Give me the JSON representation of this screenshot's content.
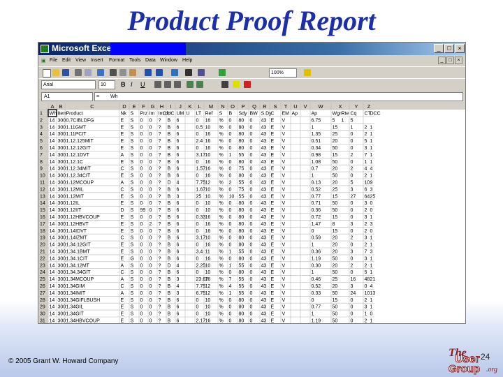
{
  "slide": {
    "title": "Product Proof Report",
    "footer": "© 2005 Grant W. Howard Company",
    "slide_number": "24",
    "logo": {
      "line1": "The",
      "line2": "User",
      "line3": "Group",
      "line4": ".org"
    }
  },
  "window": {
    "app_title": "Microsoft Excel -",
    "buttons": [
      "_",
      "□",
      "×"
    ],
    "doc_buttons": [
      "_",
      "□",
      "×"
    ]
  },
  "menu": [
    "File",
    "Edit",
    "View",
    "Insert",
    "Format",
    "Tools",
    "Data",
    "Window",
    "Help"
  ],
  "formatting": {
    "font": "Arial",
    "size": "10",
    "bold": "B",
    "italic": "I",
    "underline": "U",
    "zoom": "100%"
  },
  "formula_bar": {
    "cell_ref": "A1",
    "eq": "=",
    "content": "Wh"
  },
  "sheet": {
    "columns": [
      "A",
      "B",
      "C",
      "D",
      "E",
      "F",
      "G",
      "H",
      "I",
      "J",
      "K",
      "L",
      "M",
      "N",
      "O",
      "P",
      "Q",
      "R",
      "S",
      "T",
      "U",
      "V",
      "W",
      "X",
      "Y",
      "Z"
    ],
    "row_labels": [
      "1",
      "2",
      "3",
      "4",
      "5",
      "6",
      "7",
      "8",
      "9",
      "10",
      "11",
      "12",
      "13",
      "14",
      "15",
      "16",
      "17",
      "18",
      "19",
      "20",
      "21",
      "22",
      "23",
      "24",
      "25",
      "26",
      "27",
      "28",
      "29",
      "30",
      "31"
    ],
    "rows": [
      [
        "Wh",
        "Item",
        "Product",
        "Nk",
        "S",
        "Prz",
        "Im",
        "Im\\ndo",
        "C",
        "UC",
        "UM",
        "U",
        "LT",
        "Ref",
        "S",
        "B",
        "Sdy",
        "BW",
        "S.Dy",
        "C",
        "EM",
        "Ap",
        "Ap",
        "Wgn",
        "Rte",
        "Cq",
        "CT",
        "DCC"
      ],
      [
        "14",
        "300",
        "0.7CIBLDFG",
        "E",
        "S",
        "0",
        "0",
        "?",
        "",
        "B",
        "6",
        "",
        "0",
        "16",
        "%",
        "0",
        "80",
        "0",
        "43",
        "E",
        "V",
        "",
        "6.75",
        "5",
        "1",
        "5",
        "",
        ""
      ],
      [
        "14",
        "300",
        "1.11GMT",
        "E",
        "S",
        "0",
        "0",
        "?",
        "",
        "B",
        "6",
        "",
        "0.5",
        "10",
        "%",
        "0",
        "80",
        "0",
        "43",
        "E",
        "V",
        "",
        "1",
        "15",
        "",
        "1",
        "2",
        "1"
      ],
      [
        "14",
        "300",
        "1.11PCIT",
        "E",
        "S",
        "0",
        "0",
        "?",
        "",
        "B",
        "6",
        "",
        "0",
        "16",
        "%",
        "0",
        "80",
        "0",
        "43",
        "E",
        "V",
        "",
        "1.35",
        "25",
        "",
        "0",
        "2",
        "1"
      ],
      [
        "14",
        "300",
        "1.12.125MIT",
        "E",
        "S",
        "0",
        "0",
        "?",
        "",
        "B",
        "6",
        "",
        "2.4",
        "16",
        "%",
        "0",
        "80",
        "0",
        "43",
        "E",
        "V",
        "",
        "0.51",
        "20",
        "",
        "0",
        "5",
        "1"
      ],
      [
        "14",
        "300",
        "1.12.12GIT",
        "E",
        "S",
        "0",
        "0",
        "?",
        "",
        "B",
        "6",
        "",
        "0",
        "16",
        "%",
        "0",
        "80",
        "0",
        "43",
        "E",
        "V",
        "",
        "0.34",
        "50",
        "",
        "0",
        "3",
        "1"
      ],
      [
        "14",
        "300",
        "1.12.1DVT",
        "A",
        "S",
        "0",
        "0",
        "?",
        "",
        "B",
        "6",
        "",
        "3.17",
        "10",
        "%",
        "1",
        "55",
        "0",
        "43",
        "E",
        "V",
        "",
        "0.98",
        "15",
        "",
        "2",
        "7",
        "1"
      ],
      [
        "14",
        "300",
        "1.12.1C",
        "E",
        "S",
        "0",
        "0",
        "?",
        "",
        "B",
        "6",
        "",
        "0",
        "16",
        "%",
        "0",
        "80",
        "0",
        "43",
        "E",
        "V",
        "",
        "1.08",
        "50",
        "",
        "0",
        "1",
        "1"
      ],
      [
        "14",
        "300",
        "1.12.34MIT",
        "C",
        "S",
        "0",
        "0",
        "?",
        "",
        "B",
        "6",
        "",
        "1.57",
        "16",
        "%",
        "0",
        "75",
        "0",
        "43",
        "E",
        "V",
        "",
        "0.7",
        "20",
        "",
        "2",
        "4",
        "4"
      ],
      [
        "14",
        "300",
        "1.12.34CIT",
        "E",
        "S",
        "0",
        "0",
        "?",
        "",
        "B",
        "6",
        "",
        "0",
        "16",
        "%",
        "0",
        "80",
        "0",
        "43",
        "E",
        "V",
        "",
        "1",
        "50",
        "",
        "0",
        "2",
        "1"
      ],
      [
        "14",
        "300",
        "1.12MCOUP",
        "A",
        "S",
        "0",
        "0",
        "?",
        "",
        "D",
        "4",
        "",
        "7.75",
        "12",
        "%",
        "2",
        "55",
        "0",
        "43",
        "E",
        "V",
        "",
        "0.13",
        "20",
        "",
        "5",
        "10",
        "9"
      ],
      [
        "14",
        "300",
        "1.12MIL",
        "C",
        "S",
        "0",
        "0",
        "?",
        "",
        "B",
        "6",
        "",
        "1.67",
        "10",
        "%",
        "0",
        "75",
        "0",
        "43",
        "E",
        "V",
        "",
        "0.52",
        "25",
        "",
        "3",
        "6",
        "3"
      ],
      [
        "14",
        "300",
        "1.12MIT",
        "E",
        "S",
        "0",
        "0",
        "?",
        "",
        "B",
        "3",
        "",
        "25",
        "10",
        "%",
        "10",
        "55",
        "0",
        "43",
        "E",
        "V",
        "",
        "0.77",
        "15",
        "",
        "27",
        "64",
        "25"
      ],
      [
        "14",
        "300",
        "1.12IL",
        "E",
        "S",
        "0",
        "0",
        "?",
        "",
        "B",
        "6",
        "",
        "0",
        "10",
        "%",
        "0",
        "80",
        "0",
        "43",
        "E",
        "V",
        "",
        "0.71",
        "50",
        "",
        "0",
        "3",
        "0"
      ],
      [
        "14",
        "300",
        "1.12IIT",
        "D",
        "S",
        "99",
        "0",
        "?",
        "",
        "B",
        "6",
        "",
        "0",
        "10",
        "%",
        "0",
        "80",
        "0",
        "43",
        "E",
        "V",
        "",
        "0.36",
        "50",
        "",
        "0",
        "2",
        "0"
      ],
      [
        "14",
        "300",
        "1.12HBVCOUP",
        "E",
        "S",
        "0",
        "0",
        "?",
        "",
        "B",
        "6",
        "",
        "0.33",
        "16",
        "%",
        "0",
        "80",
        "0",
        "43",
        "E",
        "V",
        "",
        "0.72",
        "15",
        "",
        "0",
        "3",
        "1"
      ],
      [
        "14",
        "300",
        "1.12HBVT",
        "E",
        "S",
        "0",
        "2",
        "?",
        "",
        "B",
        "6",
        "",
        "0",
        "16",
        "%",
        "0",
        "80",
        "0",
        "43",
        "E",
        "V",
        "",
        "1.47",
        "8",
        "",
        "3",
        "2",
        "3"
      ],
      [
        "14",
        "300",
        "1.14IDVT",
        "E",
        "S",
        "0",
        "0",
        "?",
        "",
        "B",
        "6",
        "",
        "0",
        "16",
        "%",
        "0",
        "80",
        "0",
        "43",
        "E",
        "V",
        "",
        "0",
        "15",
        "",
        "0",
        "2",
        "0"
      ],
      [
        "14",
        "300",
        "1.14IZMT",
        "C",
        "S",
        "0",
        "0",
        "?",
        "",
        "B",
        "6",
        "",
        "3.17",
        "10",
        "%",
        "0",
        "80",
        "0",
        "43",
        "E",
        "V",
        "",
        "0.59",
        "20",
        "",
        "2",
        "3",
        "1"
      ],
      [
        "14",
        "300",
        "1.34.12GIT",
        "E",
        "S",
        "0",
        "0",
        "?",
        "",
        "B",
        "6",
        "",
        "0",
        "16",
        "%",
        "0",
        "80",
        "0",
        "43",
        "E",
        "V",
        "",
        "1",
        "20",
        "",
        "0",
        "2",
        "1"
      ],
      [
        "14",
        "300",
        "1.34.1BMT",
        "E",
        "S",
        "0",
        "0",
        "?",
        "",
        "B",
        "6",
        "",
        "3.4",
        "11",
        "%",
        "1",
        "55",
        "0",
        "43",
        "E",
        "V",
        "",
        "0.36",
        "20",
        "",
        "3",
        "7",
        "3"
      ],
      [
        "14",
        "300",
        "1.34.1CIT",
        "E",
        "G",
        "0",
        "0",
        "?",
        "",
        "B",
        "6",
        "",
        "0",
        "16",
        "%",
        "0",
        "80",
        "0",
        "43",
        "E",
        "V",
        "",
        "1.19",
        "50",
        "",
        "0",
        "3",
        "1"
      ],
      [
        "14",
        "300",
        "1.34.12MT",
        "A",
        "S",
        "0",
        "0",
        "?",
        "",
        "D",
        "4",
        "",
        "2.25",
        "10",
        "%",
        "1",
        "55",
        "0",
        "43",
        "E",
        "V",
        "",
        "0.30",
        "20",
        "",
        "2",
        "2",
        "1"
      ],
      [
        "14",
        "300",
        "1.34.34GIT",
        "C",
        "S",
        "0",
        "0",
        "?",
        "",
        "B",
        "6",
        "",
        "0",
        "10",
        "%",
        "0",
        "80",
        "0",
        "43",
        "E",
        "V",
        "",
        "1",
        "50",
        "",
        "0",
        "5",
        "1"
      ],
      [
        "14",
        "300",
        "1.34MCOUP",
        "A",
        "S",
        "0",
        "0",
        "?",
        "",
        "B",
        "3",
        "",
        "23.67",
        "16",
        "%",
        "7",
        "55",
        "0",
        "43",
        "E",
        "V",
        "",
        "0.46",
        "25",
        "",
        "16",
        "48",
        "21"
      ],
      [
        "14",
        "300",
        "1.34GIM",
        "C",
        "S",
        "0",
        "0",
        "?",
        "",
        "B",
        "4",
        "",
        "7.75",
        "12",
        "%",
        "4",
        "55",
        "0",
        "43",
        "E",
        "V",
        "",
        "0.52",
        "20",
        "",
        "3",
        "0",
        "4"
      ],
      [
        "14",
        "300",
        "1.34IMIT",
        "A",
        "S",
        "0",
        "0",
        "?",
        "",
        "B",
        "3",
        "",
        "6.75",
        "12",
        "%",
        "1",
        "55",
        "0",
        "43",
        "E",
        "V",
        "",
        "0.33",
        "50",
        "",
        "24",
        "10",
        "13"
      ],
      [
        "14",
        "300",
        "1.34GIFLBUSH",
        "E",
        "S",
        "0",
        "0",
        "?",
        "",
        "B",
        "6",
        "",
        "0",
        "10",
        "%",
        "0",
        "80",
        "0",
        "43",
        "E",
        "V",
        "",
        "0",
        "15",
        "",
        "0",
        "2",
        "1"
      ],
      [
        "14",
        "300",
        "1.34GIL",
        "E",
        "S",
        "0",
        "0",
        "?",
        "",
        "B",
        "6",
        "",
        "0",
        "10",
        "%",
        "0",
        "80",
        "0",
        "43",
        "E",
        "V",
        "",
        "0.77",
        "50",
        "",
        "0",
        "3",
        "1"
      ],
      [
        "14",
        "300",
        "1.34GIT",
        "E",
        "S",
        "0",
        "0",
        "?",
        "",
        "B",
        "6",
        "",
        "0",
        "10",
        "%",
        "0",
        "80",
        "0",
        "43",
        "E",
        "V",
        "",
        "1",
        "50",
        "",
        "0",
        "1",
        "0"
      ],
      [
        "14",
        "300",
        "1.34HBVCOUP",
        "E",
        "S",
        "0",
        "0",
        "?",
        "",
        "B",
        "6",
        "",
        "2.17",
        "16",
        "%",
        "0",
        "80",
        "0",
        "43",
        "E",
        "V",
        "",
        "1.19",
        "50",
        "",
        "0",
        "2",
        "1"
      ]
    ]
  },
  "colors": {
    "title": "#1d2fa8",
    "titlebar": "#0a246a",
    "chrome": "#d4d0c8",
    "logo": "#8b1a1a"
  },
  "icons": [
    "excel-app-icon",
    "new-icon",
    "open-icon",
    "save-icon",
    "print-icon",
    "preview-icon",
    "spell-icon",
    "cut-icon",
    "copy-icon",
    "paste-icon",
    "undo-icon",
    "redo-icon",
    "hyperlink-icon",
    "autosum-icon",
    "sort-icon",
    "chart-icon",
    "help-icon"
  ]
}
